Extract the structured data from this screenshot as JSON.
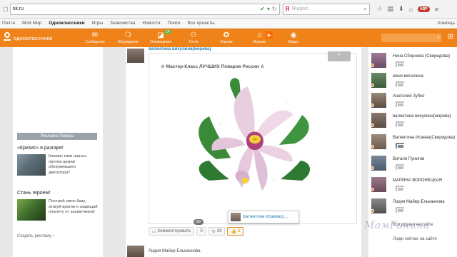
{
  "browser": {
    "url": "ok.ru",
    "yandex_logo": "Я",
    "yandex_placeholder": "Яндекс"
  },
  "topnav": {
    "items": [
      "Почта",
      "Мой Мир",
      "Одноклассники",
      "Игры",
      "Знакомства",
      "Новости",
      "Поиск",
      "Все проекты"
    ],
    "help": "помощь"
  },
  "header": {
    "logo_text": "одноклассники",
    "nav": [
      {
        "label": "Сообщения",
        "icon": "envelope-icon"
      },
      {
        "label": "Обсуждения",
        "icon": "discussions-icon"
      },
      {
        "label": "Оповещения",
        "icon": "notifications-icon",
        "badge": "14"
      },
      {
        "label": "Гости",
        "icon": "guests-icon"
      },
      {
        "label": "Оценки",
        "icon": "ratings-icon"
      },
      {
        "label": "Музыка",
        "icon": "music-icon"
      },
      {
        "label": "Видео",
        "icon": "video-icon"
      }
    ]
  },
  "left": {
    "ads_header": "Реклама Покеры",
    "ad1_title": "«Кризис» в разгаре!",
    "ad1_text": "Каковы твои шансы против армии обезумевшего диктатора?",
    "ad2_title": "Стань героем!",
    "ad2_text": "Построй свою базу, атакуй врагов и защищай планету от захватчиков!",
    "create_ad": "Создать рекламу ›"
  },
  "feed": {
    "user": "валентина вихулина(морева)",
    "card_title": "☆ Мастер-Класс ЛУЧШИХ Поваров России ☆",
    "gif": "GIF",
    "tooltip_name": "Валентина Исаева(С...",
    "comment_label": "Комментировать",
    "comment_count": "0",
    "share_count": "39",
    "class_count": "1",
    "next_user": "Лидия Майер-Ельканнова"
  },
  "right": {
    "friends": [
      {
        "name": "Нина Сборнова (Свиридова)"
      },
      {
        "name": "женя мочалина"
      },
      {
        "name": "Анатолий Зубко"
      },
      {
        "name": "валентина вихулина(морева)"
      },
      {
        "name": "Валентина Исаева(Свиридова)"
      },
      {
        "name": "Виталя Пунигов"
      },
      {
        "name": "МАРИНА ВОРОНЕЦКАЯ"
      },
      {
        "name": "Лидия Майер-Ельканнова"
      }
    ],
    "all_friends": "Все друзья на сайте",
    "people_online": "Люди сейчас на сайте"
  },
  "watermark": "МамГалина",
  "colors": {
    "brand": "#ef8319",
    "link": "#2a7fb0"
  }
}
